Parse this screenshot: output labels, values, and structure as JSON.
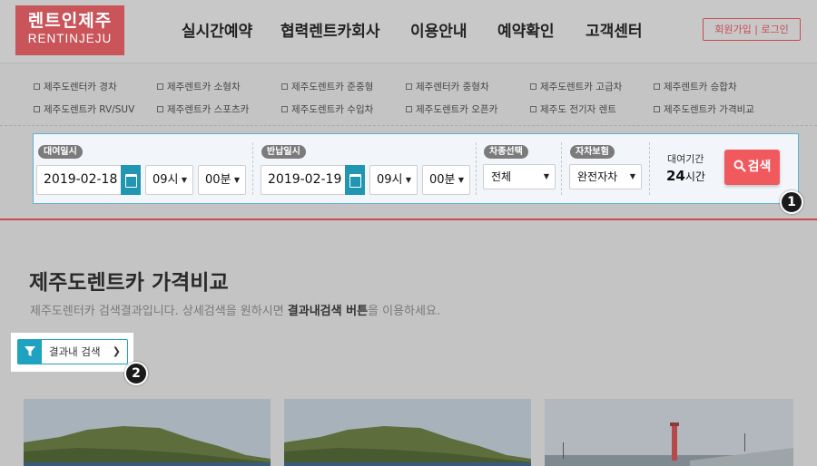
{
  "logo": {
    "kr": "렌트인제주",
    "en": "RENTINJEJU"
  },
  "nav": [
    "실시간예약",
    "협력렌트카회사",
    "이용안내",
    "예약확인",
    "고객센터"
  ],
  "auth": "회원가입 | 로그인",
  "categories": [
    "제주도렌터카 경차",
    "제주렌트카 소형차",
    "제주도렌트카 준중형",
    "제주렌터카 중형차",
    "제주도렌트카 고급차",
    "제주렌트카 승합차",
    "제주도렌트카 RV/SUV",
    "제주렌트카 스포츠카",
    "제주도렌트카 수입차",
    "제주도렌트카 오픈카",
    "제주도 전기자 렌트",
    "제주도렌트카 가격비교"
  ],
  "search": {
    "pickup_label": "대여일시",
    "pickup_date": "2019-02-18",
    "pickup_hour": "09시",
    "pickup_min": "00분",
    "return_label": "반납일시",
    "return_date": "2019-02-19",
    "return_hour": "09시",
    "return_min": "00분",
    "cartype_label": "차종선택",
    "cartype_value": "전체",
    "insurance_label": "자차보험",
    "insurance_value": "완전자차",
    "period_label": "대여기간",
    "period_num": "24",
    "period_unit": "시간",
    "button": "검색"
  },
  "badges": [
    "1",
    "2"
  ],
  "main": {
    "title": "제주도렌트카 가격비교",
    "sub_prefix": "제주도렌터카 검색결과입니다. 상세검색을 원하시면 ",
    "sub_bold": "결과내검색 버튼",
    "sub_suffix": "을 이용하세요.",
    "filter_button": "결과내 검색"
  },
  "colors": {
    "accent": "#c84c52",
    "search_button": "#f05a5f",
    "teal": "#1fa1c0"
  }
}
